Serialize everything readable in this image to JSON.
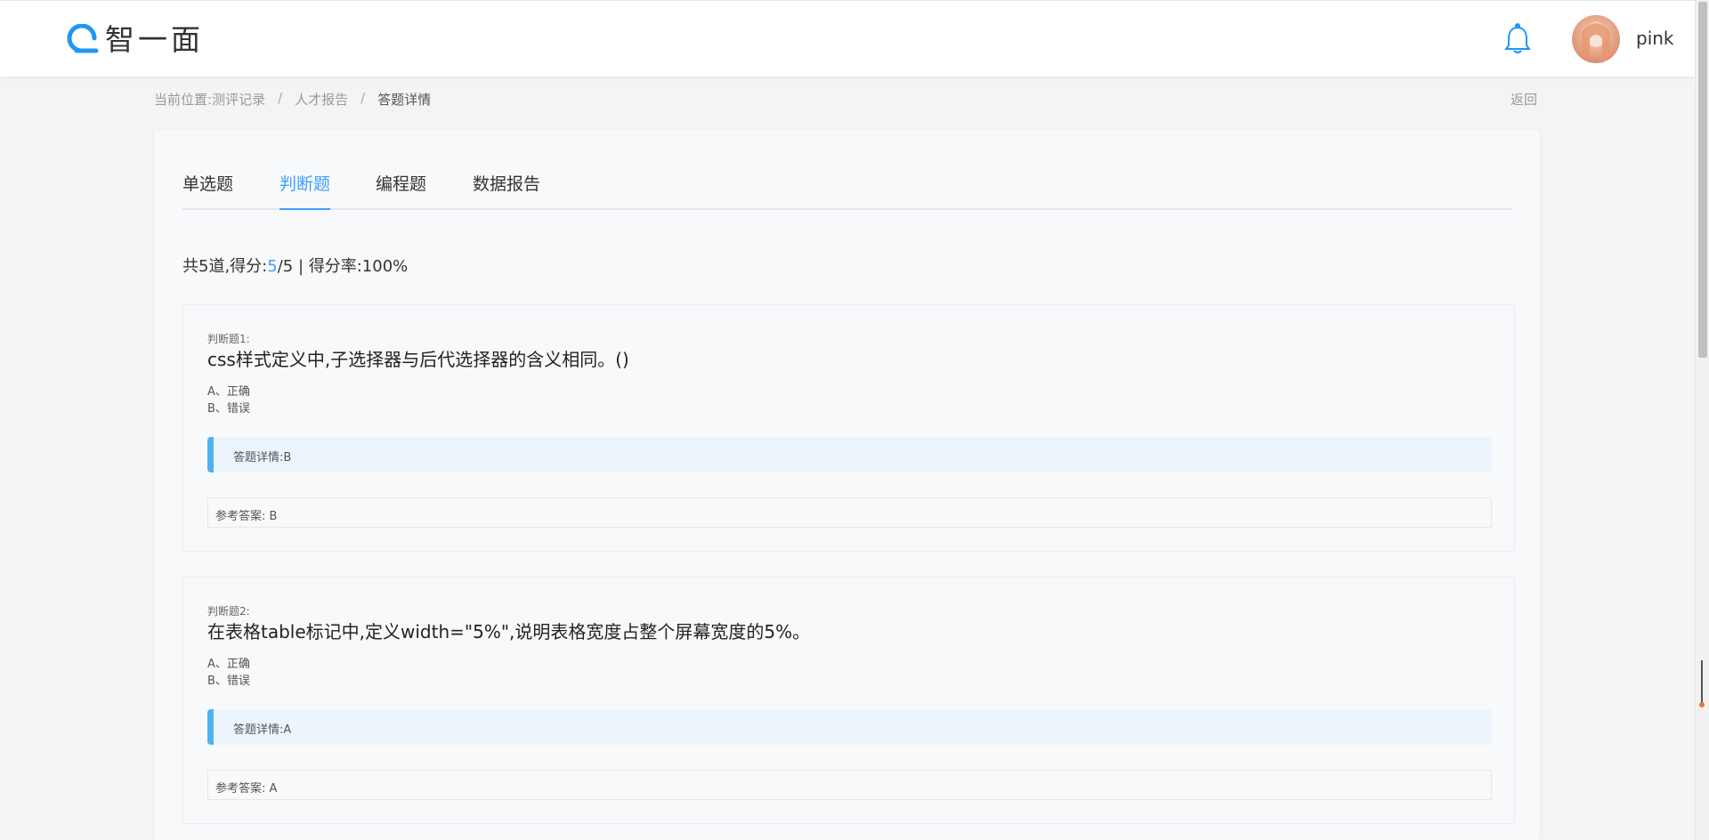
{
  "header": {
    "logo_text": "智一面",
    "username": "pink"
  },
  "breadcrumb": {
    "prefix": "当前位置:",
    "items": [
      "测评记录",
      "人才报告",
      "答题详情"
    ],
    "separator": "/",
    "back_label": "返回"
  },
  "tabs": [
    {
      "label": "单选题",
      "active": false
    },
    {
      "label": "判断题",
      "active": true
    },
    {
      "label": "编程题",
      "active": false
    },
    {
      "label": "数据报告",
      "active": false
    }
  ],
  "summary": {
    "prefix": "共5道,得分:",
    "score": "5",
    "rest": "/5 | 得分率:100%"
  },
  "questions": [
    {
      "label": "判断题1:",
      "title": "css样式定义中,子选择器与后代选择器的含义相同。()",
      "options": [
        "A、正确",
        "B、错误"
      ],
      "answer_detail": "答题详情:B",
      "reference": "参考答案: B"
    },
    {
      "label": "判断题2:",
      "title": "在表格table标记中,定义width=\"5%\",说明表格宽度占整个屏幕宽度的5%。",
      "options": [
        "A、正确",
        "B、错误"
      ],
      "answer_detail": "答题详情:A",
      "reference": "参考答案: A"
    }
  ],
  "colors": {
    "accent": "#409eff",
    "answer_bar": "#4eb3f1",
    "answer_bg": "#ecf5fc"
  },
  "icons": [
    "logo-mark-icon",
    "bell-icon",
    "avatar-image"
  ]
}
